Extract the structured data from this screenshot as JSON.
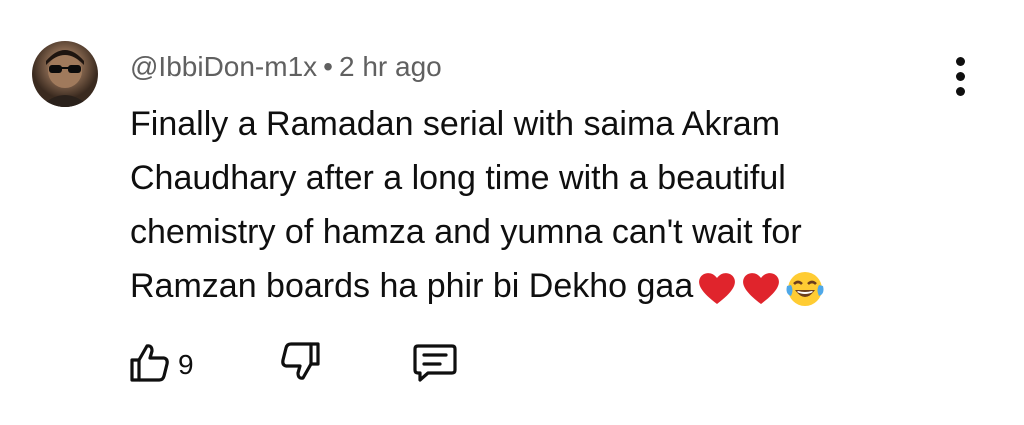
{
  "comment": {
    "author": "@IbbiDon-m1x",
    "separator": "•",
    "time": "2 hr ago",
    "text_lines": [
      "Finally a Ramadan serial with saima Akram",
      "Chaudhary after a long time with a beautiful",
      "chemistry of hamza and yumna can't wait for",
      "Ramzan boards ha phir bi Dekho gaa"
    ],
    "emojis": [
      "red-heart",
      "red-heart",
      "face-with-tears-of-joy"
    ],
    "likes": "9"
  },
  "icons": {
    "avatar": "user-avatar",
    "more": "vertical-ellipsis-icon",
    "like": "thumbs-up-icon",
    "dislike": "thumbs-down-icon",
    "reply": "comment-reply-icon"
  },
  "colors": {
    "text": "#0f0f0f",
    "meta": "#606060",
    "heart": "#e0242c",
    "emoji_face": "#ffcc33"
  }
}
